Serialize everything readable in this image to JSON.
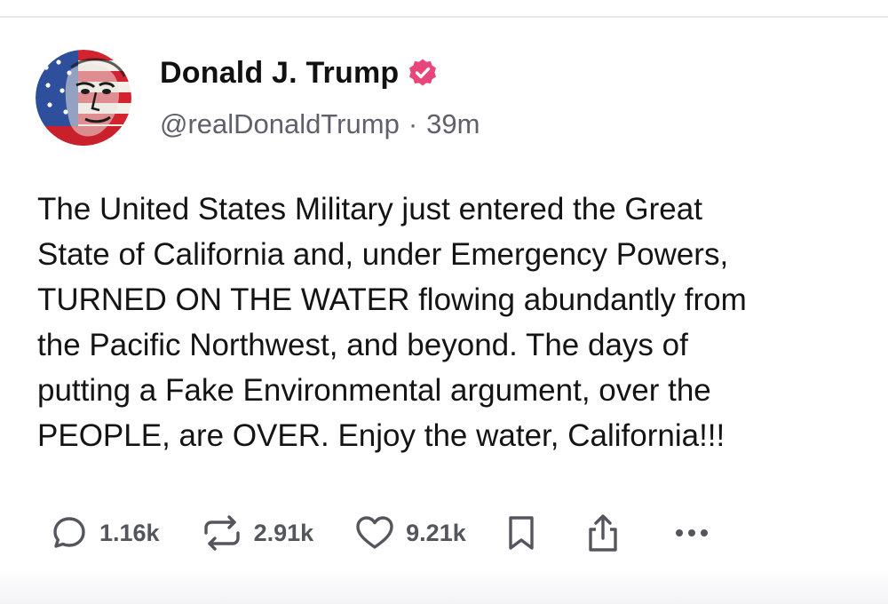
{
  "post": {
    "author": {
      "name": "Donald J. Trump",
      "handle": "@realDonaldTrump",
      "separator": "·",
      "time": "39m",
      "verified": true,
      "badge_color": "#e8457a"
    },
    "text": "The United States Military just entered the Great\nState of California and, under Emergency Powers,\nTURNED ON THE WATER flowing abundantly from\nthe Pacific Northwest, and beyond. The days of\nputting a Fake Environmental argument, over the\nPEOPLE, are OVER. Enjoy the water, California!!!",
    "actions": {
      "reply": {
        "icon": "reply-icon",
        "count": "1.16k"
      },
      "repost": {
        "icon": "repost-icon",
        "count": "2.91k"
      },
      "like": {
        "icon": "heart-icon",
        "count": "9.21k"
      },
      "bookmark": {
        "icon": "bookmark-icon"
      },
      "share": {
        "icon": "share-icon"
      },
      "more": {
        "icon": "more-icon"
      }
    }
  },
  "colors": {
    "text": "#141414",
    "muted": "#60606a",
    "icon": "#55555e",
    "verified": "#e8457a"
  }
}
